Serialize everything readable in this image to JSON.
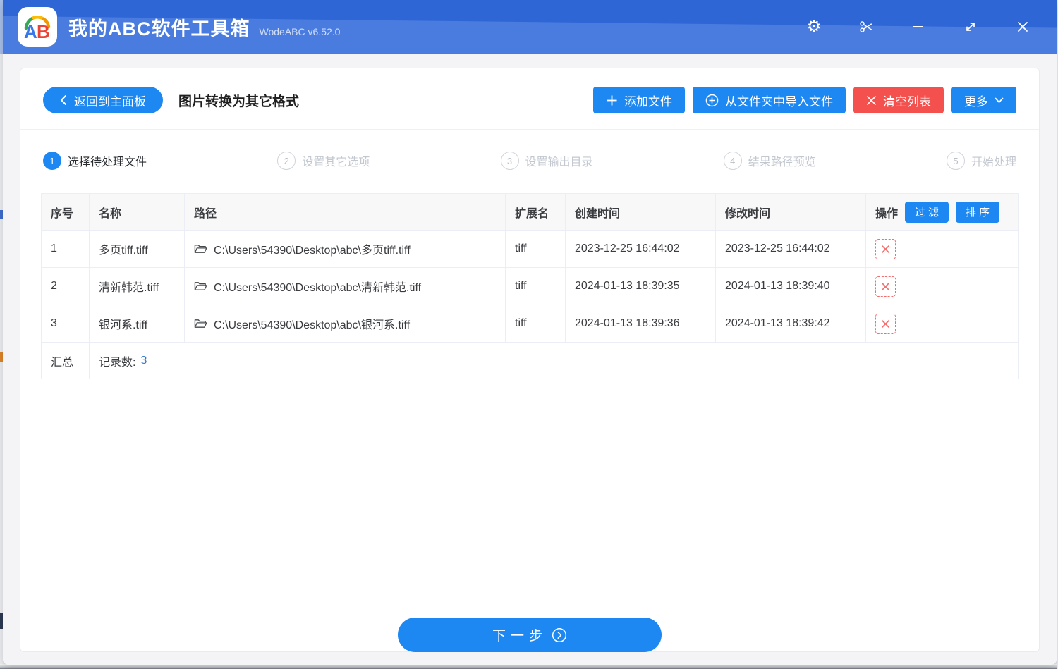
{
  "window": {
    "title": "我的ABC软件工具箱",
    "version": "WodeABC v6.52.0",
    "logo_text": "AB"
  },
  "icons": {
    "gear_glyph": "⚙",
    "names": [
      "gear-icon",
      "scissors-icon",
      "minimize-icon",
      "resize-icon",
      "close-icon",
      "plus-icon",
      "circle-plus-icon",
      "x-icon",
      "chevron-down-icon",
      "chevron-left-icon",
      "folder-open-icon",
      "circle-chevron-right-icon",
      "delete-x-icon"
    ]
  },
  "toolbar": {
    "back_label": "返回到主面板",
    "page_title": "图片转换为其它格式",
    "add_files_label": "添加文件",
    "import_folder_label": "从文件夹中导入文件",
    "clear_list_label": "清空列表",
    "more_label": "更多"
  },
  "steps": [
    {
      "num": "1",
      "label": "选择待处理文件"
    },
    {
      "num": "2",
      "label": "设置其它选项"
    },
    {
      "num": "3",
      "label": "设置输出目录"
    },
    {
      "num": "4",
      "label": "结果路径预览"
    },
    {
      "num": "5",
      "label": "开始处理"
    }
  ],
  "table": {
    "headers": [
      "序号",
      "名称",
      "路径",
      "扩展名",
      "创建时间",
      "修改时间",
      "操作"
    ],
    "filter_label": "过滤",
    "sort_label": "排序",
    "rows": [
      {
        "index": "1",
        "name": "多页tiff.tiff",
        "path": "C:\\Users\\54390\\Desktop\\abc\\多页tiff.tiff",
        "ext": "tiff",
        "created": "2023-12-25 16:44:02",
        "modified": "2023-12-25 16:44:02"
      },
      {
        "index": "2",
        "name": "清新韩范.tiff",
        "path": "C:\\Users\\54390\\Desktop\\abc\\清新韩范.tiff",
        "ext": "tiff",
        "created": "2024-01-13 18:39:35",
        "modified": "2024-01-13 18:39:40"
      },
      {
        "index": "3",
        "name": "银河系.tiff",
        "path": "C:\\Users\\54390\\Desktop\\abc\\银河系.tiff",
        "ext": "tiff",
        "created": "2024-01-13 18:39:36",
        "modified": "2024-01-13 18:39:42"
      }
    ],
    "summary": {
      "label": "汇总",
      "text": "记录数:",
      "count": "3"
    }
  },
  "footer": {
    "next_label": "下一步"
  },
  "colors": {
    "primary": "#1e88f2",
    "danger": "#f4514e",
    "titlebar_dark": "#2e66d6",
    "titlebar_light": "#4a7ce0",
    "table_border": "#ebeef5"
  }
}
